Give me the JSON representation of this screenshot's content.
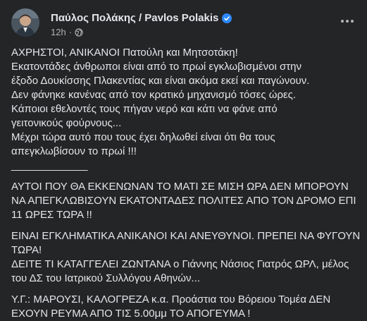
{
  "post": {
    "author": "Παύλος Πολάκης / Pavlos Polakis",
    "time": "12h",
    "separator": "·",
    "icons": {
      "avatar": "profile-photo",
      "verified": "verified-badge-icon",
      "audience": "globe-icon",
      "more": "more-options-icon"
    },
    "colors": {
      "background": "#242526",
      "text": "#e4e6eb",
      "secondary": "#b0b3b8",
      "verified": "#2d88ff"
    },
    "paragraph1": [
      "ΑΧΡΗΣΤΟΙ, ΑΝΙΚΑΝΟΙ Πατούλη και Μητσοτάκη!",
      "Εκατοντάδες άνθρωποι είναι από το πρωί εγκλωβισμένοι στην",
      "έξοδο Δουκίσσης Πλακεντίας και είναι ακόμα εκεί και παγώνουν.",
      "Δεν φάνηκε κανένας από τον κρατικό μηχανισμό τόσες ώρες.",
      "Κάποιοι εθελοντές τους πήγαν νερό και κάτι να φάνε από",
      "γειτονικούς φούρνους...",
      "Μέχρι τώρα αυτό που τους έχει δηλωθεί είναι ότι θα τους",
      "απεγκλωβίσουν το πρωί !!!"
    ],
    "divider": "_____________",
    "paragraph2": [
      "ΑΥΤΟΙ ΠΟΥ ΘΑ ΕΚΚΕΝΩΝΑΝ ΤΟ ΜΑΤΙ ΣΕ ΜΙΣΗ ΩΡΑ ΔΕΝ ΜΠΟΡΟΥΝ",
      "ΝΑ ΑΠΕΓΚΛΩΒΙΣΟΥΝ ΕΚΑΤΟΝΤΑΔΕΣ ΠΟΛΙΤΕΣ ΑΠΟ ΤΟΝ ΔΡΟΜΟ ΕΠΙ",
      "11 ΩΡΕΣ ΤΩΡΑ !!"
    ],
    "paragraph3": [
      "ΕΙΝΑΙ ΕΓΚΛΗΜΑΤΙΚΑ ΑΝΙΚΑΝΟΙ ΚΑΙ ΑΝΕΥΘΥΝΟΙ. ΠΡΕΠΕΙ ΝΑ ΦΥΓΟΥΝ",
      "ΤΩΡΑ!",
      "ΔΕΙΤΕ ΤΙ ΚΑΤΑΓΓΕΛΕΙ ΖΩΝΤΑΝΑ ο Γιάννης Νάσιος Γιατρός ΩΡΛ, μέλος",
      "του ΔΣ του Ιατρικού Συλλόγου Αθηνών..."
    ],
    "paragraph4": [
      "Υ.Γ.: ΜΑΡΟΥΣΙ, ΚΑΛΟΓΡΕΖΑ κ.α. Προάστια του Βόρειου Τομέα ΔΕΝ",
      "ΕΧΟΥΝ ΡΕΥΜΑ ΑΠΟ ΤΙΣ 5.00μμ ΤΟ ΑΠΟΓΕΥΜΑ !"
    ]
  }
}
